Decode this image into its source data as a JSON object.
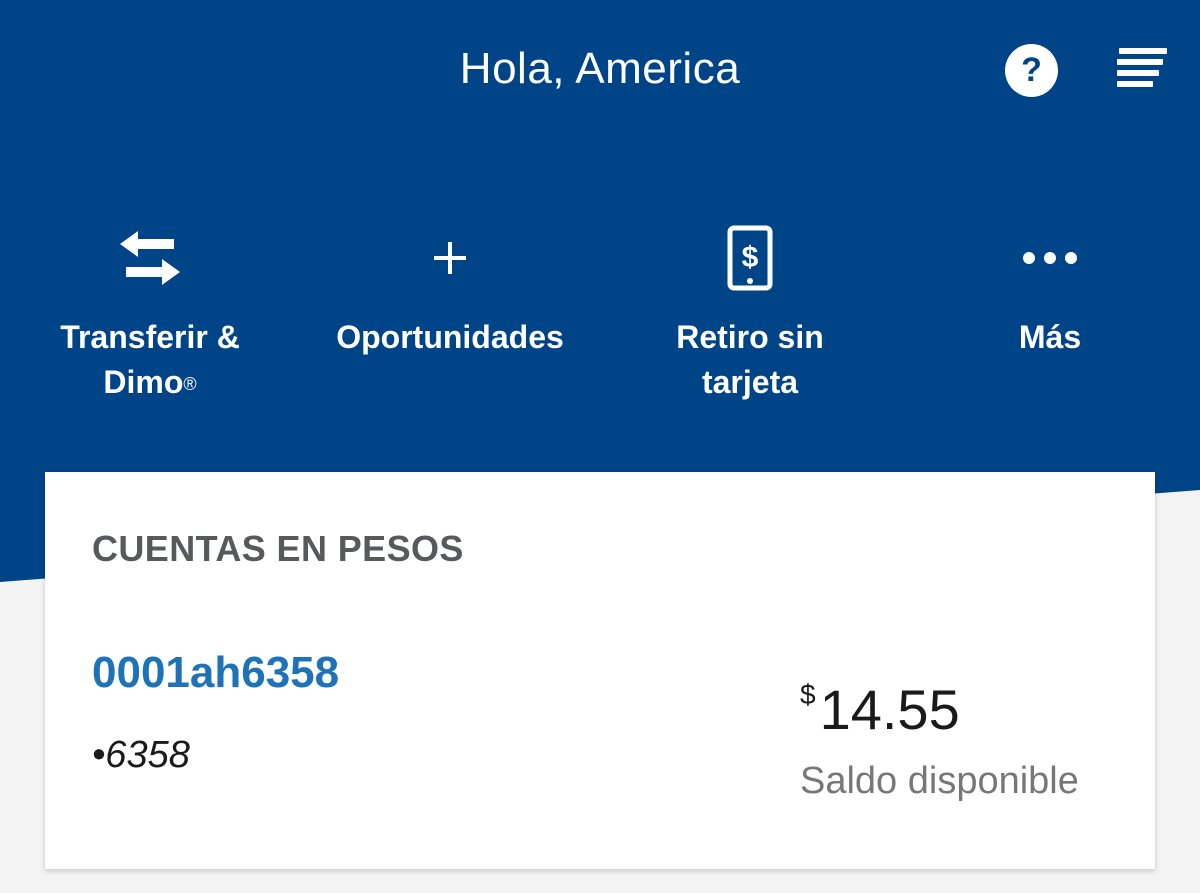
{
  "colors": {
    "brand_blue": "#004488",
    "account_link": "#1d72b8",
    "background": "#f3f3f3",
    "card": "#ffffff"
  },
  "header": {
    "greeting": "Hola, America",
    "help_icon": "question-circle-icon",
    "help_glyph": "?",
    "menu_icon": "hamburger-menu-icon"
  },
  "actions": [
    {
      "label": "Transferir &\nDimo",
      "mark": "®",
      "icon": "transfer-arrows-icon"
    },
    {
      "label": "Oportunidades",
      "icon": "plus-icon"
    },
    {
      "label": "Retiro sin\ntarjeta",
      "icon": "phone-dollar-icon"
    },
    {
      "label": "Más",
      "icon": "more-dots-icon"
    }
  ],
  "accounts_section": {
    "title": "CUENTAS EN PESOS",
    "accounts": [
      {
        "name": "0001ah6358",
        "masked_number": "•6358",
        "currency_symbol": "$",
        "balance": "14.55",
        "balance_label": "Saldo disponible"
      }
    ]
  }
}
